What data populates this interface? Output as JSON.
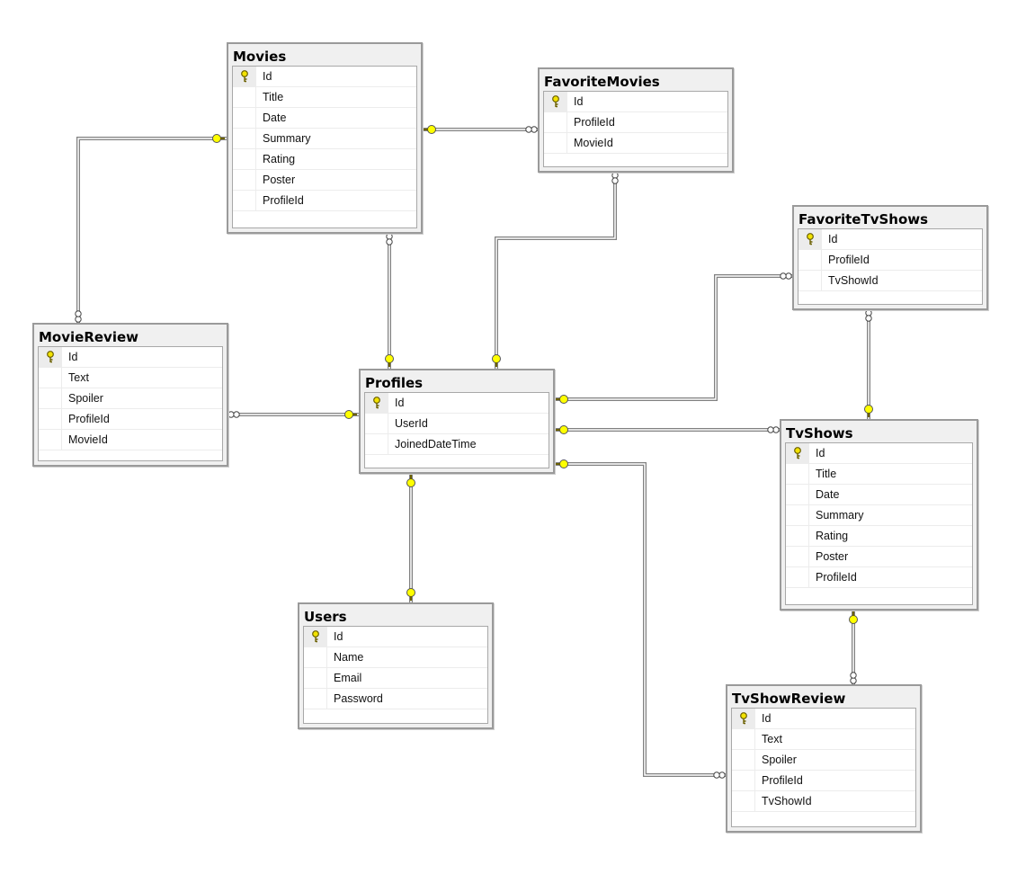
{
  "diagram": {
    "tables": [
      {
        "id": "movies",
        "name": "Movies",
        "columns": [
          {
            "name": "Id",
            "pk": true
          },
          {
            "name": "Title"
          },
          {
            "name": "Date"
          },
          {
            "name": "Summary"
          },
          {
            "name": "Rating"
          },
          {
            "name": "Poster"
          },
          {
            "name": "ProfileId"
          }
        ]
      },
      {
        "id": "favoritemovies",
        "name": "FavoriteMovies",
        "columns": [
          {
            "name": "Id",
            "pk": true
          },
          {
            "name": "ProfileId"
          },
          {
            "name": "MovieId"
          }
        ]
      },
      {
        "id": "favoritetvshows",
        "name": "FavoriteTvShows",
        "columns": [
          {
            "name": "Id",
            "pk": true
          },
          {
            "name": "ProfileId"
          },
          {
            "name": "TvShowId"
          }
        ]
      },
      {
        "id": "moviereview",
        "name": "MovieReview",
        "columns": [
          {
            "name": "Id",
            "pk": true
          },
          {
            "name": "Text"
          },
          {
            "name": "Spoiler"
          },
          {
            "name": "ProfileId"
          },
          {
            "name": "MovieId"
          }
        ]
      },
      {
        "id": "profiles",
        "name": "Profiles",
        "columns": [
          {
            "name": "Id",
            "pk": true
          },
          {
            "name": "UserId"
          },
          {
            "name": "JoinedDateTime"
          }
        ]
      },
      {
        "id": "tvshows",
        "name": "TvShows",
        "columns": [
          {
            "name": "Id",
            "pk": true
          },
          {
            "name": "Title"
          },
          {
            "name": "Date"
          },
          {
            "name": "Summary"
          },
          {
            "name": "Rating"
          },
          {
            "name": "Poster"
          },
          {
            "name": "ProfileId"
          }
        ]
      },
      {
        "id": "users",
        "name": "Users",
        "columns": [
          {
            "name": "Id",
            "pk": true
          },
          {
            "name": "Name"
          },
          {
            "name": "Email"
          },
          {
            "name": "Password"
          }
        ]
      },
      {
        "id": "tvshowreview",
        "name": "TvShowReview",
        "columns": [
          {
            "name": "Id",
            "pk": true
          },
          {
            "name": "Text"
          },
          {
            "name": "Spoiler"
          },
          {
            "name": "ProfileId"
          },
          {
            "name": "TvShowId"
          }
        ]
      }
    ],
    "colors": {
      "key": "#ffff00",
      "line": "#808080"
    }
  }
}
